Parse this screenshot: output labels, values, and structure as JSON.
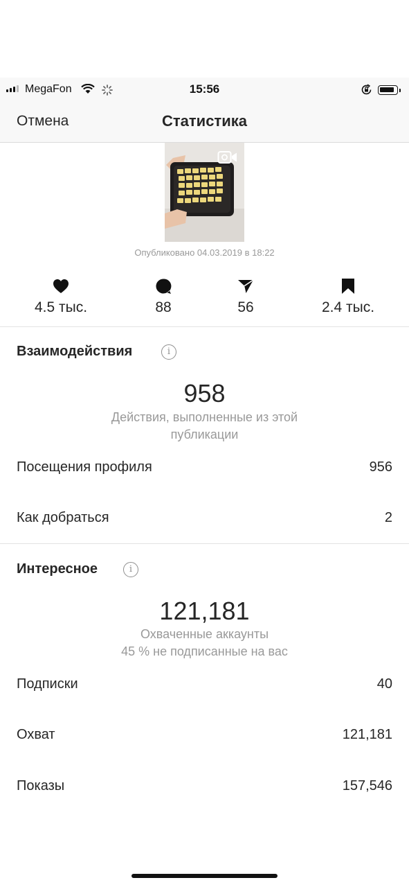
{
  "status_bar": {
    "carrier": "MegaFon",
    "time": "15:56",
    "signal_bars": 3,
    "signal_total": 4,
    "icons": [
      "signal-icon",
      "wifi-icon",
      "activity-spinner-icon",
      "rotation-lock-icon",
      "battery-icon"
    ]
  },
  "nav": {
    "cancel": "Отмена",
    "title": "Статистика"
  },
  "post": {
    "video_icon": "video-camera-icon",
    "published": "Опубликовано 04.03.2019 в 18:22"
  },
  "metrics": [
    {
      "icon": "heart-icon",
      "value": "4.5 тыс."
    },
    {
      "icon": "comment-icon",
      "value": "88"
    },
    {
      "icon": "share-icon",
      "value": "56"
    },
    {
      "icon": "bookmark-icon",
      "value": "2.4 тыс."
    }
  ],
  "interactions": {
    "title": "Взаимодействия",
    "info": "i",
    "total": "958",
    "caption_line1": "Действия, выполненные из этой",
    "caption_line2": "публикации",
    "rows": [
      {
        "label": "Посещения профиля",
        "value": "956"
      },
      {
        "label": "Как добраться",
        "value": "2"
      }
    ]
  },
  "discovery": {
    "title": "Интересное",
    "info": "i",
    "total": "121,181",
    "caption_line1": "Охваченные аккаунты",
    "caption_line2": "45 % не подписанные на вас",
    "rows": [
      {
        "label": "Подписки",
        "value": "40"
      },
      {
        "label": "Охват",
        "value": "121,181"
      },
      {
        "label": "Показы",
        "value": "157,546"
      }
    ]
  },
  "colors": {
    "text": "#262626",
    "secondary": "#999999",
    "bar_background": "#f8f8f8",
    "divider": "#e3e3e3"
  }
}
